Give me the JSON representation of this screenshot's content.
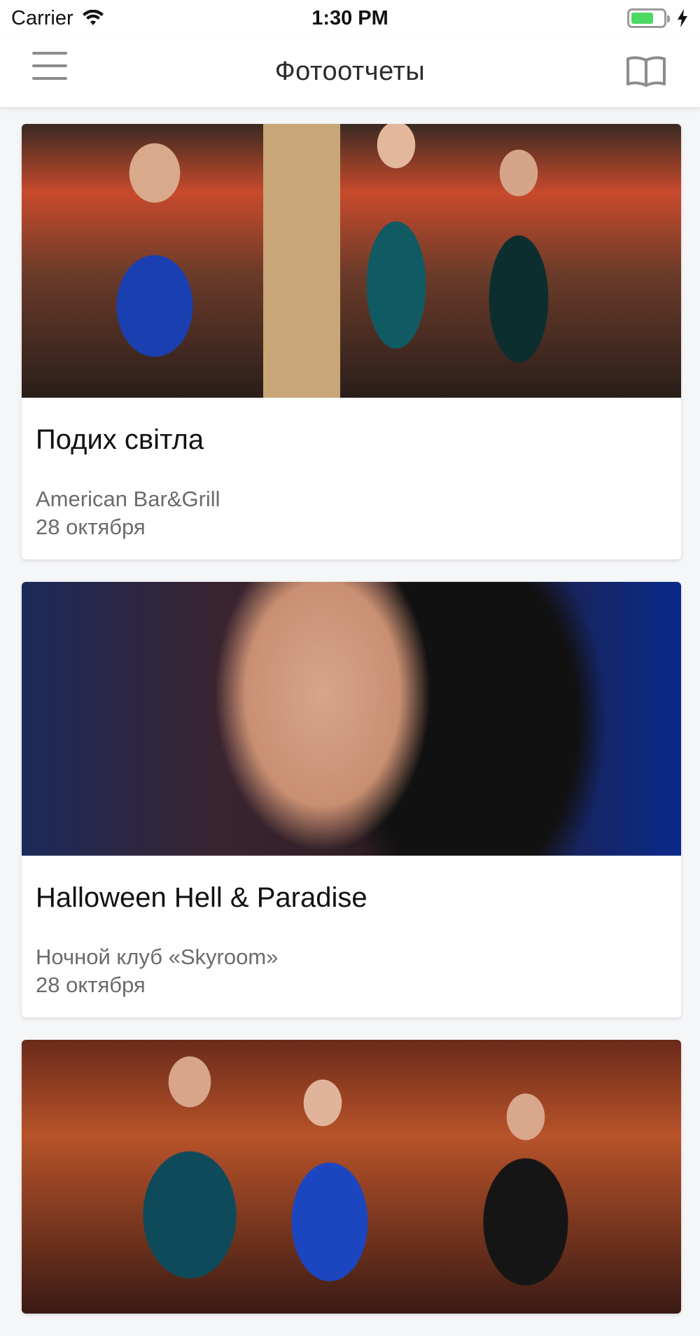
{
  "status_bar": {
    "carrier": "Carrier",
    "time": "1:30 PM",
    "battery_color": "#4cd964"
  },
  "nav": {
    "title": "Фотоотчеты",
    "menu_icon": "hamburger-menu-icon",
    "right_icon": "book-icon"
  },
  "reports": [
    {
      "title": "Подих світла",
      "venue": "American Bar&Grill",
      "date": "28 октября",
      "photo": "event-photo"
    },
    {
      "title": "Halloween Hell & Paradise",
      "venue": "Ночной клуб «Skyroom»",
      "date": "28 октября",
      "photo": "event-photo"
    },
    {
      "photo": "event-photo"
    }
  ]
}
